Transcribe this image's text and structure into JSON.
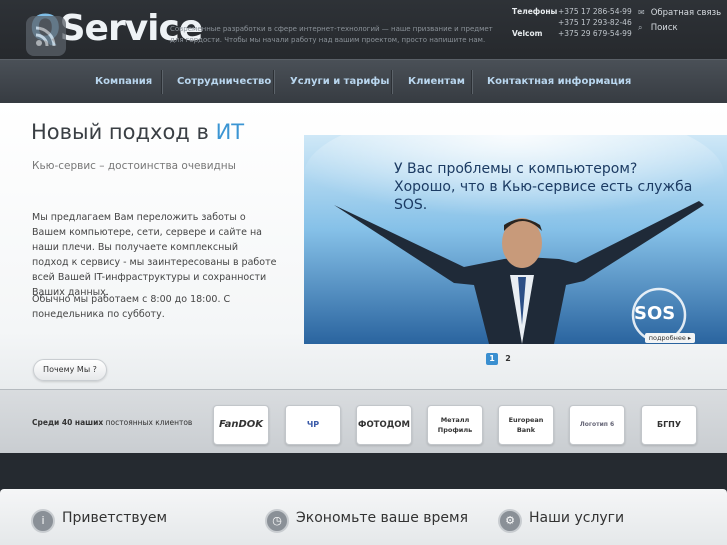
{
  "header": {
    "logo_q": "Q",
    "logo_rest": "Service",
    "tagline": "Современные разработки в сфере интернет-технологий — наше призвание и предмет для гордости. Чтобы мы начали работу над вашим проектом, просто напишите нам.",
    "phones_label": "Телефоны",
    "phone1": "+375 17 286-54-99",
    "phone2": "+375 17 293-82-46",
    "velcom_label": "Velcom",
    "phone3": "+375 29 679-54-99",
    "links": [
      {
        "label": "Обратная связь",
        "icon": "mail-icon"
      },
      {
        "label": "Поиск",
        "icon": "search-icon"
      }
    ]
  },
  "nav": {
    "items": [
      {
        "label": "Компания"
      },
      {
        "label": "Сотрудничество"
      },
      {
        "label": "Услуги и тарифы"
      },
      {
        "label": "Клиентам"
      },
      {
        "label": "Контактная информация"
      }
    ]
  },
  "hero": {
    "title_main": "Новый подход в",
    "title_accent": "ИТ",
    "subtitle": "Кью-сервис – достоинства очевидны",
    "paragraph1": "Мы предлагаем Вам переложить заботы о Вашем компьютере, сети, сервере и сайте на наши плечи. Вы получаете комплексный подход к сервису - мы заинтересованы в работе всей Вашей IT-инфраструктуры и сохранности Ваших данных.",
    "paragraph2": "Обычно мы работаем с 8:00 до 18:00. С понедельника по субботу.",
    "why_button": "Почему Мы ?",
    "banner_text": "У Вас проблемы с компьютером? Хорошо, что в Кью-сервисе есть служба SOS.",
    "banner_sos": "SOS",
    "more_badge": "подробнее ▸",
    "pages": [
      "1",
      "2"
    ]
  },
  "clients": {
    "label_bold": "Среди 40 наших",
    "label_rest": "постоянных клиентов",
    "logos": [
      {
        "name": "FanDOK"
      },
      {
        "name": "ЧР"
      },
      {
        "name": "ФОТОДОМ"
      },
      {
        "name": "Металл Профиль"
      },
      {
        "name": "European Bank"
      },
      {
        "name": "Логотип 6"
      },
      {
        "name": "БГПУ"
      }
    ]
  },
  "bottom": {
    "items": [
      {
        "label": "Приветствуем",
        "icon": "info-icon"
      },
      {
        "label": "Экономьте ваше время",
        "icon": "clock-icon"
      },
      {
        "label": "Наши услуги",
        "icon": "gear-icon"
      }
    ]
  }
}
